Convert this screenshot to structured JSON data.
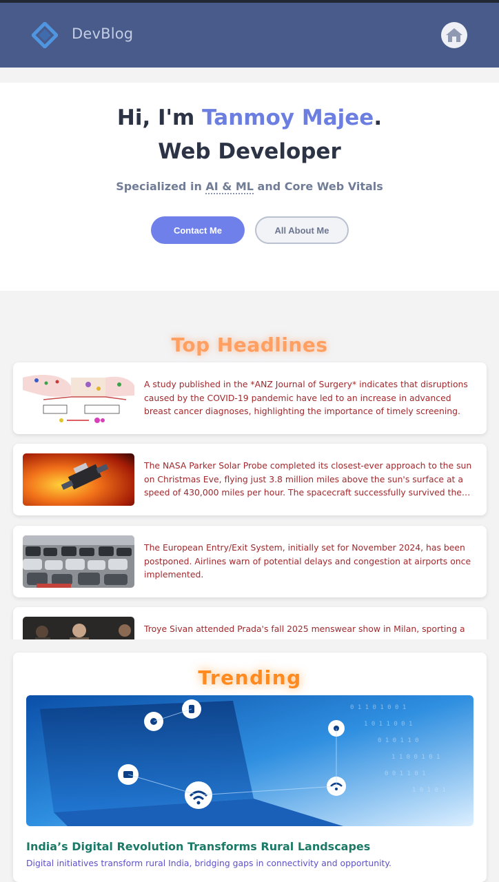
{
  "header": {
    "brand": "DevBlog",
    "logo_icon": "diamond-logo-icon",
    "home_icon": "home-icon",
    "bg_color": "#485b8b"
  },
  "hero": {
    "greeting_prefix": "Hi, I'm ",
    "name": "Tanmoy Majee",
    "greeting_suffix": ".",
    "role": "Web Developer",
    "subtitle_prefix": "Specialized in ",
    "subtitle_highlight": "AI & ML",
    "subtitle_suffix": " and Core Web Vitals",
    "contact_label": "Contact Me",
    "about_label": "All About Me",
    "accent_color": "#6c7fe0"
  },
  "headlines": {
    "title": "Top Headlines",
    "items": [
      {
        "text": "A study published in the *ANZ Journal of Surgery* indicates that disruptions caused by the COVID-19 pandemic have led to an increase in advanced breast cancer diagnoses, highlighting the importance of timely screening.",
        "image": "medical-diagram-thumbnail"
      },
      {
        "text": "The NASA Parker Solar Probe completed its closest-ever approach to the sun on Christmas Eve, flying just 3.8 million miles above the sun's surface at a speed of 430,000 miles per hour. The spacecraft successfully survived the…",
        "image": "solar-probe-thumbnail"
      },
      {
        "text": "The European Entry/Exit System, initially set for November 2024, has been postponed. Airlines warn of potential delays and congestion at airports once implemented.",
        "image": "traffic-queue-thumbnail"
      },
      {
        "text": "Troye Sivan attended Prada's fall 2025 menswear show in Milan, sporting a",
        "image": "fashion-show-thumbnail"
      }
    ],
    "text_color": "#a0282c"
  },
  "trending": {
    "title": "Trending",
    "headline": "India’s Digital Revolution Transforms Rural Landscapes",
    "description": "Digital initiatives transform rural India, bridging gaps in connectivity and opportunity.",
    "image": "digital-network-illustration",
    "headline_color": "#1b7a67",
    "description_color": "#5b4fc9"
  }
}
